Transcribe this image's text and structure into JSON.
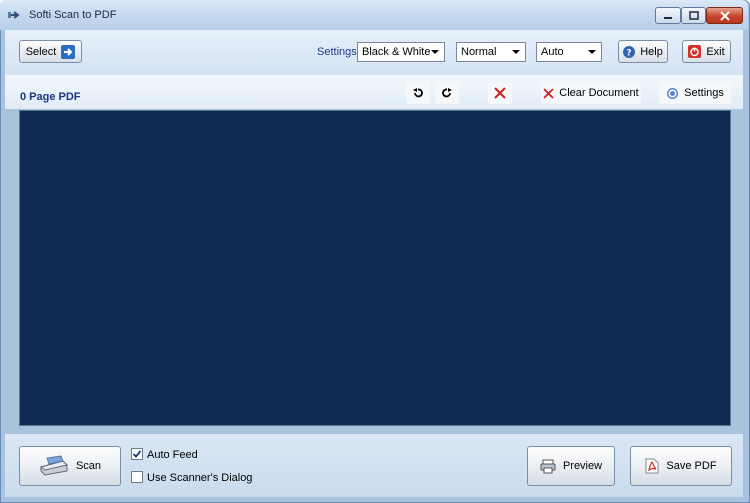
{
  "window": {
    "title": "Softi Scan to PDF"
  },
  "toolbar": {
    "select_label": "Select",
    "settings_label": "Settings:",
    "color_mode": "Black & White",
    "quality": "Normal",
    "page_size": "Auto",
    "help_label": "Help",
    "exit_label": "Exit"
  },
  "document": {
    "title": "0 Page PDF",
    "clear_label": "Clear Document",
    "settings_label": "Settings"
  },
  "bottom": {
    "scan_label": "Scan",
    "auto_feed_label": "Auto Feed",
    "auto_feed_checked": true,
    "scanner_dialog_label": "Use Scanner's Dialog",
    "scanner_dialog_checked": false,
    "preview_label": "Preview",
    "save_pdf_label": "Save PDF"
  },
  "colors": {
    "preview_background": "#0e2a52",
    "accent_blue": "#1a3580"
  }
}
